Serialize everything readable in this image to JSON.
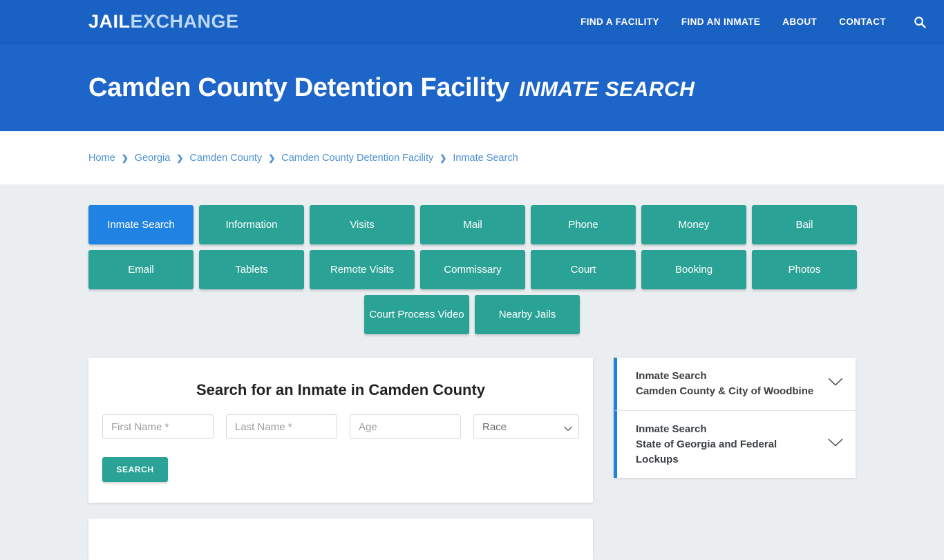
{
  "header": {
    "logo_part1": "JAIL",
    "logo_part2": "EXCHANGE",
    "nav": [
      {
        "label": "FIND A FACILITY"
      },
      {
        "label": "FIND AN INMATE"
      },
      {
        "label": "ABOUT"
      },
      {
        "label": "CONTACT"
      }
    ],
    "search_icon": "search-icon",
    "bg_color": "#1a61c4"
  },
  "hero": {
    "title": "Camden County Detention Facility",
    "subtitle": "INMATE SEARCH",
    "bg_color": "#1d65c9"
  },
  "breadcrumb": {
    "separator": "❯",
    "items": [
      {
        "label": "Home"
      },
      {
        "label": "Georgia"
      },
      {
        "label": "Camden County"
      },
      {
        "label": "Camden County Detention Facility"
      },
      {
        "label": "Inmate Search"
      }
    ]
  },
  "tabs": {
    "active_color": "#2083e4",
    "default_color": "#2aa396",
    "row1": [
      {
        "label": "Inmate Search",
        "active": true
      },
      {
        "label": "Information",
        "active": false
      },
      {
        "label": "Visits",
        "active": false
      },
      {
        "label": "Mail",
        "active": false
      },
      {
        "label": "Phone",
        "active": false
      },
      {
        "label": "Money",
        "active": false
      },
      {
        "label": "Bail",
        "active": false
      }
    ],
    "row2": [
      {
        "label": "Email"
      },
      {
        "label": "Tablets"
      },
      {
        "label": "Remote Visits"
      },
      {
        "label": "Commissary"
      },
      {
        "label": "Court"
      },
      {
        "label": "Booking"
      },
      {
        "label": "Photos"
      }
    ],
    "row3": [
      {
        "label": "Court Process Video"
      },
      {
        "label": "Nearby Jails"
      }
    ]
  },
  "search_form": {
    "title": "Search for an Inmate in Camden County",
    "first_name_placeholder": "First Name *",
    "first_name_value": "",
    "last_name_placeholder": "Last Name *",
    "last_name_value": "",
    "age_placeholder": "Age",
    "age_value": "",
    "race_selected": "Race",
    "submit_label": "SEARCH"
  },
  "sidebar": {
    "accent_color": "#1f82d8",
    "items": [
      {
        "line1": "Inmate Search",
        "line2": "Camden County & City of Woodbine",
        "chevron": "chevron-down-icon"
      },
      {
        "line1": "Inmate Search",
        "line2": "State of Georgia and Federal Lockups",
        "chevron": "chevron-down-icon"
      }
    ]
  }
}
